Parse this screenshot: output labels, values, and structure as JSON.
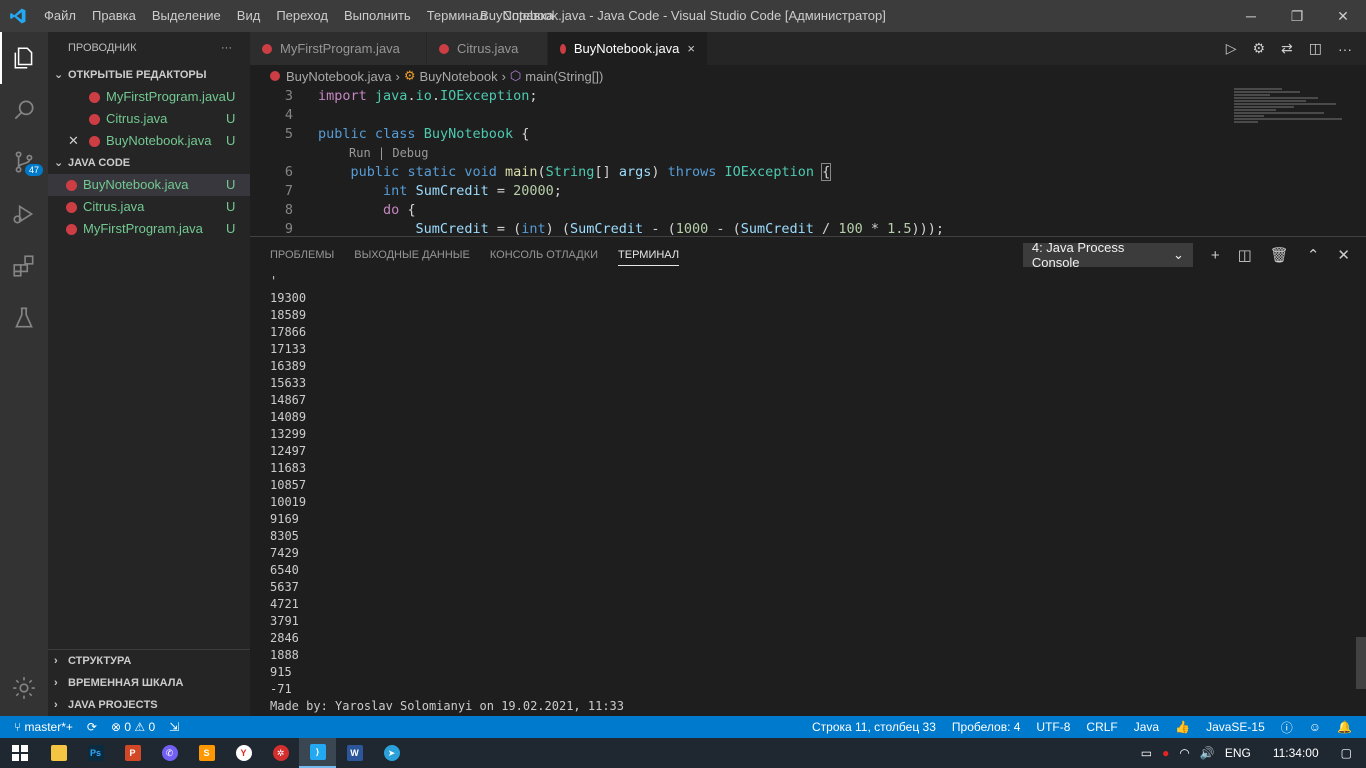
{
  "titlebar": {
    "menu": [
      "Файл",
      "Правка",
      "Выделение",
      "Вид",
      "Переход",
      "Выполнить",
      "Терминал",
      "Справка"
    ],
    "window_title": "BuyNotebook.java - Java Code - Visual Studio Code [Администратор]"
  },
  "activity": {
    "scm_badge": "47"
  },
  "sidebar": {
    "title": "ПРОВОДНИК",
    "more": "···",
    "open_editors_header": "ОТКРЫТЫЕ РЕДАКТОРЫ",
    "open_editors": [
      {
        "name": "MyFirstProgram.java",
        "status": "U"
      },
      {
        "name": "Citrus.java",
        "status": "U"
      },
      {
        "name": "BuyNotebook.java",
        "status": "U"
      }
    ],
    "folder_header": "JAVA CODE",
    "files": [
      {
        "name": "BuyNotebook.java",
        "status": "U"
      },
      {
        "name": "Citrus.java",
        "status": "U"
      },
      {
        "name": "MyFirstProgram.java",
        "status": "U"
      }
    ],
    "bottom_sections": [
      "СТРУКТУРА",
      "ВРЕМЕННАЯ ШКАЛА",
      "JAVA PROJECTS"
    ]
  },
  "tabs": [
    {
      "label": "MyFirstProgram.java"
    },
    {
      "label": "Citrus.java"
    },
    {
      "label": "BuyNotebook.java",
      "close": "×"
    }
  ],
  "breadcrumb": {
    "file": "BuyNotebook.java",
    "cls": "BuyNotebook",
    "method": "main(String[])"
  },
  "editor": {
    "line_numbers": [
      "3",
      "4",
      "5",
      "6",
      "7",
      "8",
      "9"
    ],
    "codelens": "Run | Debug"
  },
  "panel": {
    "tabs": [
      "ПРОБЛЕМЫ",
      "ВЫХОДНЫЕ ДАННЫЕ",
      "КОНСОЛЬ ОТЛАДКИ",
      "ТЕРМИНАЛ"
    ],
    "terminal_select": "4: Java Process Console",
    "output": [
      "'",
      "19300",
      "18589",
      "17866",
      "17133",
      "16389",
      "15633",
      "14867",
      "14089",
      "13299",
      "12497",
      "11683",
      "10857",
      "10019",
      "9169",
      "8305",
      "7429",
      "6540",
      "5637",
      "4721",
      "3791",
      "2846",
      "1888",
      "915",
      "-71",
      "Made by: Yaroslav Solomianyi on 19.02.2021, 11:33"
    ]
  },
  "statusbar": {
    "branch": "master*+",
    "errors": "0",
    "warnings": "0",
    "position": "Строка 11, столбец 33",
    "spaces": "Пробелов: 4",
    "encoding": "UTF-8",
    "eol": "CRLF",
    "language": "Java",
    "jdk": "JavaSE-15"
  },
  "taskbar": {
    "lang": "ENG",
    "time": "11:34:00"
  }
}
